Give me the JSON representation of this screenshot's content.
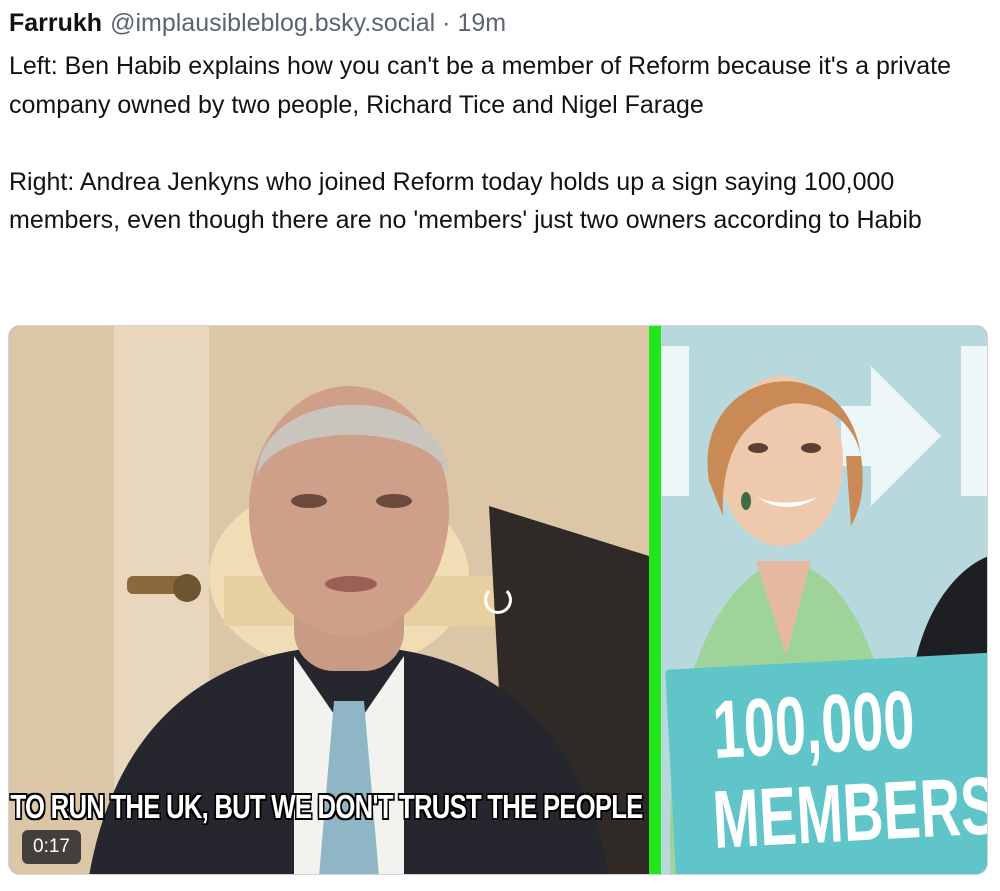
{
  "post": {
    "author_name": "Farrukh",
    "author_handle": "@implausibleblog.bsky.social",
    "separator": "·",
    "timestamp": "19m",
    "paragraphs": [
      "Left: Ben Habib explains how you can't be a member of Reform because it's a private company owned by two people, Richard Tice and Nigel Farage",
      "Right: Andrea Jenkyns who joined Reform today holds up a sign saying 100,000 members, even though there are no 'members' just two owners according to Habib"
    ]
  },
  "video": {
    "caption": "TO RUN THE UK, BUT WE DON'T TRUST THE PEOPLE",
    "duration": "0:17",
    "loading_icon": "spinner-icon",
    "sign_number": "100,000",
    "sign_word": "MEMBERS",
    "colors": {
      "divider": "#22e51c",
      "sign": "#5fc5c8"
    }
  }
}
